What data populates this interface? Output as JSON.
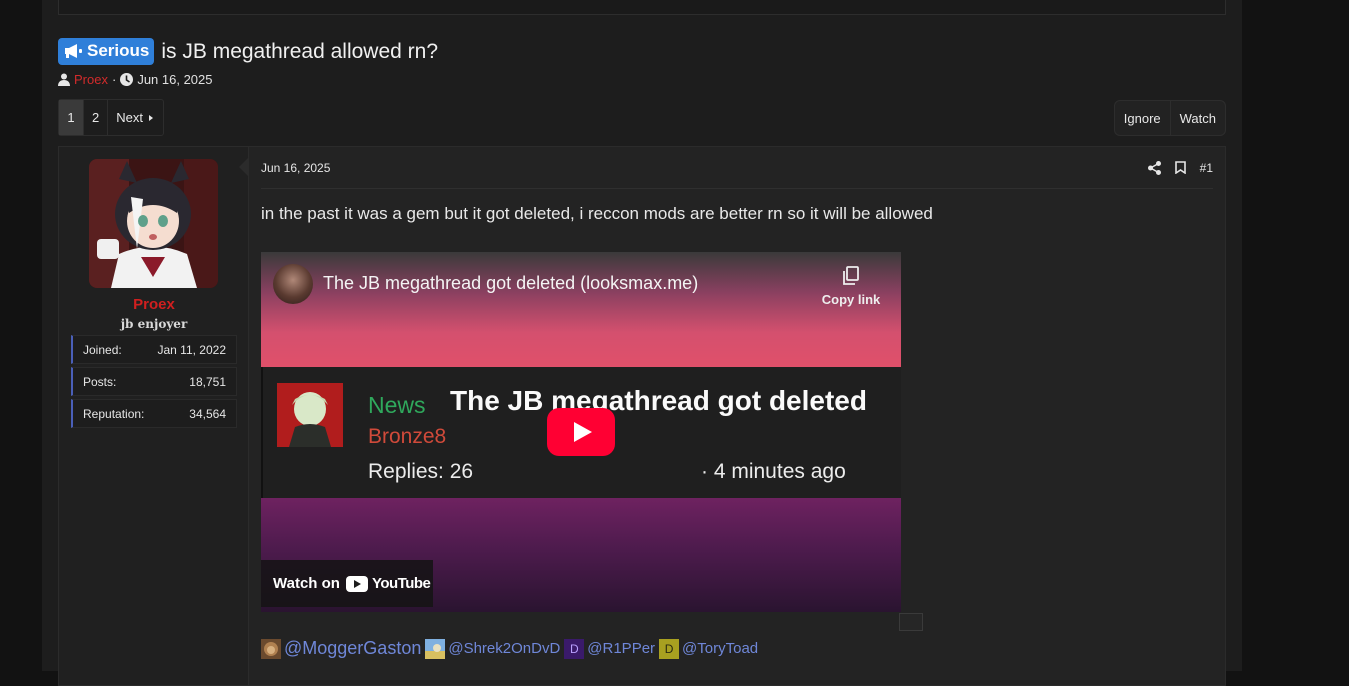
{
  "thread": {
    "prefix": "Serious",
    "title": "is JB megathread allowed rn?",
    "author": "Proex",
    "separator": "·",
    "date": "Jun 16, 2025"
  },
  "pagination": {
    "pages": [
      "1",
      "2"
    ],
    "current": "1",
    "next_label": "Next"
  },
  "thread_actions": {
    "ignore_label": "Ignore",
    "watch_label": "Watch"
  },
  "post": {
    "date": "Jun 16, 2025",
    "number": "#1",
    "text": "in the past it was a gem but it got deleted, i reccon mods are better rn so it will be allowed",
    "user": {
      "name": "Proex",
      "title": "jb enjoyer",
      "stats": [
        {
          "label": "Joined:",
          "value": "Jan 11, 2022"
        },
        {
          "label": "Posts:",
          "value": "18,751"
        },
        {
          "label": "Reputation:",
          "value": "34,564"
        }
      ]
    },
    "video": {
      "title": "The JB megathread got deleted (looksmax.me)",
      "copy_link": "Copy link",
      "card_tag": "News",
      "card_title": "The JB megathread got deleted",
      "card_author": "Bronze8",
      "card_replies": "Replies: 26",
      "card_time": "· 4 minutes ago",
      "watch_on": "Watch on",
      "youtube": "YouTube"
    },
    "mentions": [
      {
        "name": "@MoggerGaston",
        "avatar": ""
      },
      {
        "name": "@Shrek2OnDvD",
        "avatar": ""
      },
      {
        "name": "@R1PPer",
        "avatar": "D"
      },
      {
        "name": "@ToryToad",
        "avatar": "D"
      }
    ]
  },
  "colors": {
    "prefix_bg": "#2f7fd9",
    "username": "#d01f1f",
    "mention": "#6f87d8",
    "news": "#2fa85c",
    "youtube_red": "#ff0033"
  }
}
